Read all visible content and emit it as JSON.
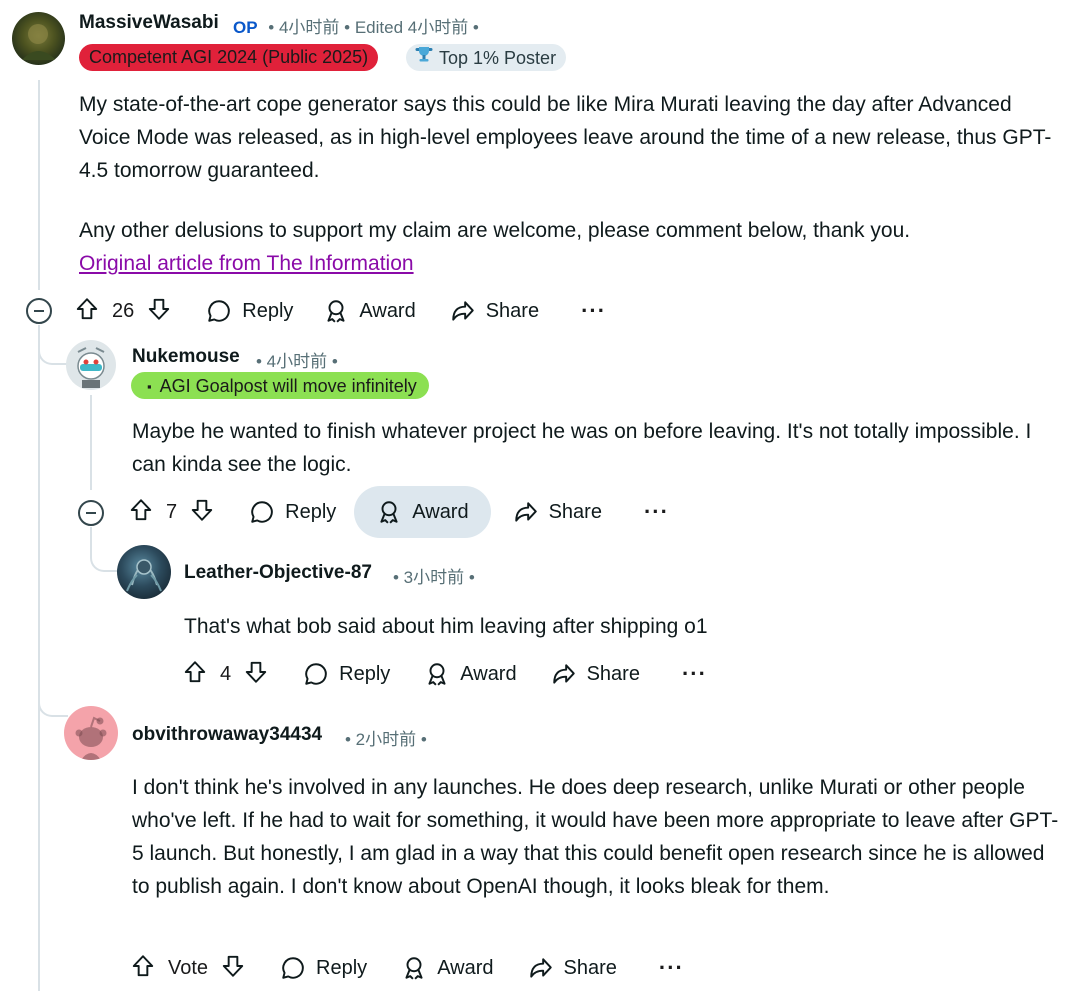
{
  "comments": [
    {
      "username": "MassiveWasabi",
      "op_label": "OP",
      "meta": "• 4小时前 • Edited 4小时前 •",
      "flairs": [
        {
          "text": "Competent AGI 2024 (Public 2025)",
          "bg": "#e0213a",
          "fg": "#1a1a1a"
        },
        {
          "text": "Top 1% Poster",
          "bg": "#e4ecf1",
          "fg": "#2a3c42",
          "icon": "trophy-icon"
        }
      ],
      "paragraphs": [
        "My state-of-the-art cope generator says this could be like Mira Murati leaving the day after Advanced Voice Mode was released, as in high-level employees leave around the time of a new release, thus GPT-4.5 tomorrow guaranteed.",
        "Any other delusions to support my claim are welcome, please comment below, thank you."
      ],
      "link_text": "Original article from The Information",
      "votes": "26",
      "actions": {
        "reply": "Reply",
        "award": "Award",
        "share": "Share",
        "more": "···"
      }
    },
    {
      "username": "Nukemouse",
      "meta": "• 4小时前 •",
      "flairs": [
        {
          "text": "AGI Goalpost will move infinitely",
          "bg": "#8ce052",
          "fg": "#1a1a1a",
          "prefix": "▪"
        }
      ],
      "paragraphs": [
        "Maybe he wanted to finish whatever project he was on before leaving. It's not totally impossible. I can kinda see the logic."
      ],
      "votes": "7",
      "actions": {
        "reply": "Reply",
        "award": "Award",
        "share": "Share",
        "more": "···"
      }
    },
    {
      "username": "Leather-Objective-87",
      "meta": "• 3小时前 •",
      "paragraphs": [
        "That's what bob said about him leaving after shipping o1"
      ],
      "votes": "4",
      "actions": {
        "reply": "Reply",
        "award": "Award",
        "share": "Share",
        "more": "···"
      }
    },
    {
      "username": "obvithrowaway34434",
      "meta": "• 2小时前 •",
      "paragraphs": [
        "I don't think he's involved in any launches. He does deep research, unlike Murati or other people who've left. If he had to wait for something, it would have been more appropriate to leave after GPT-5 launch. But honestly, I am glad in a way that this could benefit open research since he is allowed to publish again. I don't know about OpenAI though, it looks bleak for them."
      ],
      "votes": "Vote",
      "actions": {
        "reply": "Reply",
        "award": "Award",
        "share": "Share",
        "more": "···"
      }
    }
  ],
  "colors": {
    "accent_link": "#8a0aa8",
    "op": "#0a58ca",
    "thread_line": "#d9e1e6",
    "award_highlight": "#dde7ee"
  }
}
